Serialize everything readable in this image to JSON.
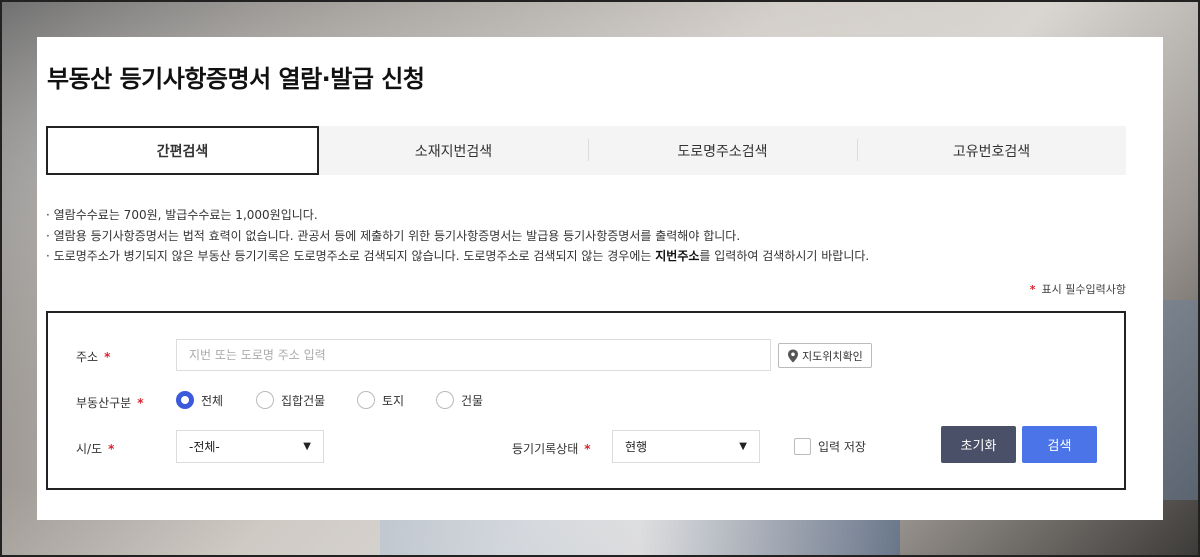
{
  "page": {
    "title": "부동산 등기사항증명서 열람·발급 신청"
  },
  "tabs": [
    {
      "label": "간편검색",
      "active": true
    },
    {
      "label": "소재지번검색",
      "active": false
    },
    {
      "label": "도로명주소검색",
      "active": false
    },
    {
      "label": "고유번호검색",
      "active": false
    }
  ],
  "notes": {
    "line1": "· 열람수수료는  700원, 발급수수료는  1,000원입니다.",
    "line2": "· 열람용 등기사항증명서는 법적 효력이 없습니다. 관공서 등에 제출하기 위한 등기사항증명서는 발급용 등기사항증명서를 출력해야 합니다.",
    "line3_before": "· 도로명주소가 병기되지 않은 부동산 등기기록은 도로명주소로 검색되지 않습니다. 도로명주소로 검색되지 않는 경우에는 ",
    "line3_bold": "지번주소",
    "line3_after": "를 입력하여 검색하시기 바랍니다."
  },
  "required_legend": {
    "star": "*",
    "text": "표시 필수입력사항"
  },
  "form": {
    "address": {
      "label": "주소",
      "required": "*",
      "placeholder": "지번 또는 도로명 주소 입력",
      "value": "",
      "map_button": "지도위치확인"
    },
    "property_type": {
      "label": "부동산구분",
      "required": "*",
      "options": [
        {
          "label": "전체",
          "checked": true
        },
        {
          "label": "집합건물",
          "checked": false
        },
        {
          "label": "토지",
          "checked": false
        },
        {
          "label": "건물",
          "checked": false
        }
      ]
    },
    "sido": {
      "label": "시/도",
      "required": "*",
      "selected": "-전체-"
    },
    "record_status": {
      "label": "등기기록상태",
      "required": "*",
      "selected": "현행"
    },
    "save_input": {
      "label": "입력 저장",
      "checked": false
    },
    "reset_button": "초기화",
    "search_button": "검색"
  },
  "colors": {
    "accent": "#4a74e8",
    "reset": "#4a5068",
    "required": "#d9232d",
    "radio_checked": "#3b5bdb"
  }
}
